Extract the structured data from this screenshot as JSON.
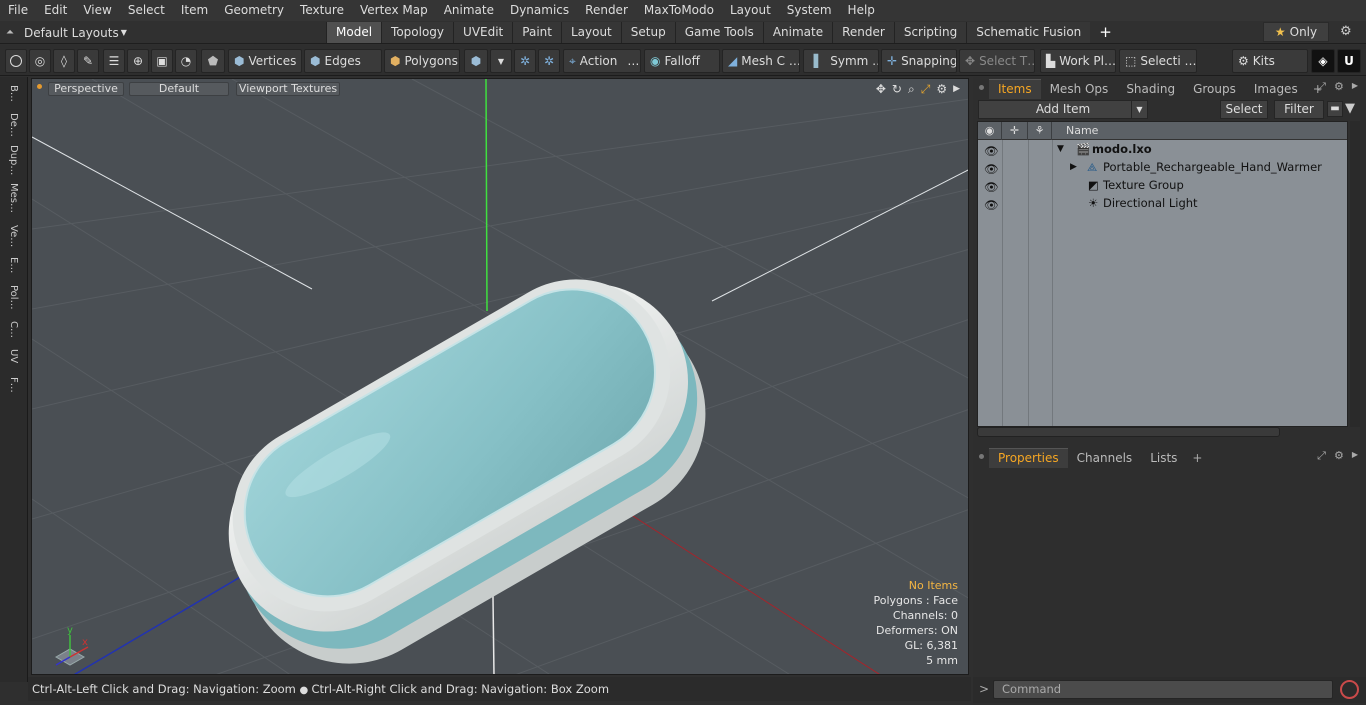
{
  "menu": [
    "File",
    "Edit",
    "View",
    "Select",
    "Item",
    "Geometry",
    "Texture",
    "Vertex Map",
    "Animate",
    "Dynamics",
    "Render",
    "MaxToModo",
    "Layout",
    "System",
    "Help"
  ],
  "layout_selector": "Default Layouts",
  "tabs": [
    "Model",
    "Topology",
    "UVEdit",
    "Paint",
    "Layout",
    "Setup",
    "Game Tools",
    "Animate",
    "Render",
    "Scripting",
    "Schematic Fusion"
  ],
  "active_tab": "Model",
  "only_label": "Only",
  "toolbar": {
    "vertices": "Vertices",
    "edges": "Edges",
    "polygons": "Polygons",
    "action": "Action",
    "action_more": "…",
    "falloff": "Falloff",
    "mesh": "Mesh C …",
    "symm": "Symm …",
    "snapping": "Snapping",
    "select_t": "Select T…",
    "workpl": "Work Pl…",
    "selecti": "Selecti …",
    "kits": "Kits"
  },
  "sidebar_tabs": [
    "B…",
    "De…",
    "Dup…",
    "Mes…",
    "Ve…",
    "E…",
    "Pol…",
    "C…",
    "UV",
    "F…"
  ],
  "viewport": {
    "perspective": "Perspective",
    "default": "Default",
    "textures": "Viewport Textures",
    "stats": {
      "no_items": "No Items",
      "polygons": "Polygons : Face",
      "channels": "Channels: 0",
      "deformers": "Deformers: ON",
      "gl": "GL: 6,381",
      "unit": "5 mm"
    },
    "axis": {
      "y": "y",
      "x": "x"
    }
  },
  "status_text_1": "Ctrl-Alt-Left Click and Drag: Navigation: Zoom",
  "status_text_2": "Ctrl-Alt-Right Click and Drag: Navigation: Box Zoom",
  "items_panel": {
    "tabs": [
      "Items",
      "Mesh Ops",
      "Shading",
      "Groups",
      "Images"
    ],
    "active": "Items",
    "add_item": "Add Item",
    "select": "Select",
    "filter": "Filter",
    "name_header": "Name",
    "rows": [
      {
        "label": "modo.lxo"
      },
      {
        "label": "Portable_Rechargeable_Hand_Warmer"
      },
      {
        "label": "Texture Group"
      },
      {
        "label": "Directional Light"
      }
    ]
  },
  "props_panel": {
    "tabs": [
      "Properties",
      "Channels",
      "Lists"
    ],
    "active": "Properties"
  },
  "command_placeholder": "Command",
  "colors": {
    "accent": "#f5a623",
    "body_teal": "#8fc6cc",
    "shell_white": "#e9eceb"
  }
}
